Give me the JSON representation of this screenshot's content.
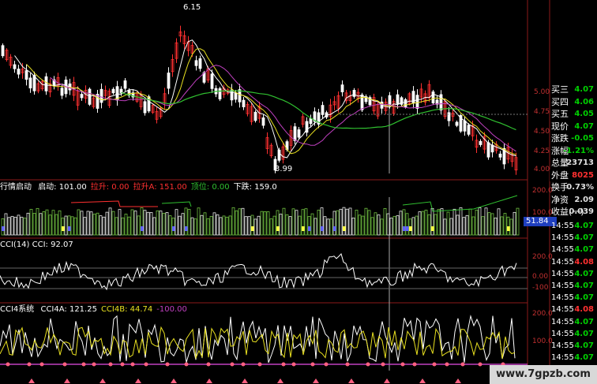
{
  "colors": {
    "up": "#ff3030",
    "down": "#ffffff",
    "ma_white": "#ffffff",
    "ma_yellow": "#e8e020",
    "ma_purple": "#c040c0",
    "ma_green": "#30c030",
    "frame": "#8b1a1a",
    "accent": "#3366ff"
  },
  "price_chart": {
    "type": "candlestick",
    "ylim": [
      3.9,
      6.3
    ],
    "y_ticks": [
      "5.00",
      "4.75",
      "4.50",
      "4.25",
      "4.00"
    ],
    "high_label": "6.15",
    "low_label": "3.99"
  },
  "indicator1": {
    "title": "行情启动",
    "params": [
      {
        "label": "启动: 101.00",
        "color": "#ffffff"
      },
      {
        "label": "拉升: 0.00",
        "color": "#ff3030"
      },
      {
        "label": "拉升A: 151.00",
        "color": "#ff3030"
      },
      {
        "label": "顶位: 0.00",
        "color": "#30c030"
      },
      {
        "label": "下跌: 159.0",
        "color": "#ffffff"
      }
    ],
    "y_ticks": [
      "200.0",
      "100.0"
    ],
    "value_badge": "51.84"
  },
  "indicator2": {
    "title": "CCI(14)",
    "value_label": "CCI: 92.07",
    "y_ticks": [
      "200.0",
      "0.00",
      "-100"
    ]
  },
  "indicator3": {
    "title": "CCI4系统",
    "params": [
      {
        "label": "CCI4A: 121.25",
        "color": "#ffffff"
      },
      {
        "label": "CCI4B: 44.74",
        "color": "#e8e020"
      },
      {
        "label": "-100.00",
        "color": "#c040c0"
      }
    ],
    "y_ticks": [
      "200.0",
      "100.0"
    ]
  },
  "quote_panel": {
    "rows": [
      {
        "k": "买三",
        "v": "4.07",
        "c": "#00d000"
      },
      {
        "k": "买四",
        "v": "4.06",
        "c": "#00d000"
      },
      {
        "k": "买五",
        "v": "4.05",
        "c": "#00d000"
      },
      {
        "k": "现价",
        "v": "4.07",
        "c": "#00d000"
      },
      {
        "k": "涨跌",
        "v": "-0.05",
        "c": "#00d000"
      },
      {
        "k": "涨幅",
        "v": "-1.21%",
        "c": "#00d000"
      },
      {
        "k": "总量",
        "v": "23713",
        "c": "#e0e0e0"
      },
      {
        "k": "外盘",
        "v": "8025",
        "c": "#ff3030"
      },
      {
        "k": "换手",
        "v": "0.73%",
        "c": "#e0e0e0"
      },
      {
        "k": "净资",
        "v": "2.09",
        "c": "#e0e0e0"
      },
      {
        "k": "收益(一)",
        "v": "0.039",
        "c": "#e0e0e0"
      }
    ],
    "ticks": [
      {
        "t": "14:55",
        "v": "4.07",
        "c": "#00d000"
      },
      {
        "t": "14:55",
        "v": "4.07",
        "c": "#00d000"
      },
      {
        "t": "14:55",
        "v": "4.07",
        "c": "#00d000"
      },
      {
        "t": "14:55",
        "v": "4.08",
        "c": "#ff3030"
      },
      {
        "t": "14:55",
        "v": "4.07",
        "c": "#00d000"
      },
      {
        "t": "14:55",
        "v": "4.07",
        "c": "#00d000"
      },
      {
        "t": "14:55",
        "v": "4.07",
        "c": "#00d000"
      },
      {
        "t": "14:55",
        "v": "4.08",
        "c": "#ff3030"
      },
      {
        "t": "14:55",
        "v": "4.07",
        "c": "#00d000"
      },
      {
        "t": "14:55",
        "v": "4.07",
        "c": "#00d000"
      },
      {
        "t": "14:55",
        "v": "4.07",
        "c": "#00d000"
      },
      {
        "t": "14:55",
        "v": "4.07",
        "c": "#00d000"
      }
    ]
  },
  "watermark": "www.7gpzb.com"
}
